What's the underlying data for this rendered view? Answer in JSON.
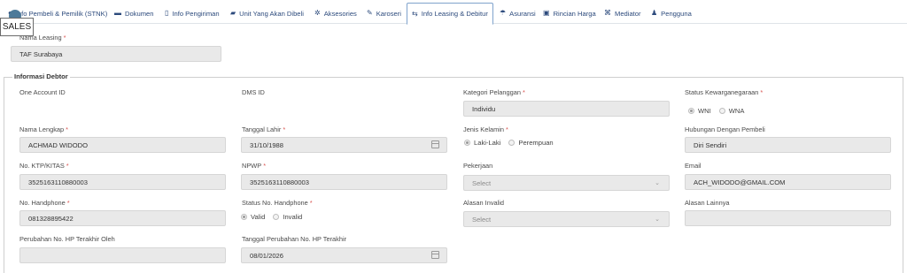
{
  "tabs": [
    {
      "label": "Info Pembeli & Pemilik (STNK)",
      "icon": "user-icon",
      "glyph": "●"
    },
    {
      "label": "Dokumen",
      "icon": "folder-icon",
      "glyph": "▬"
    },
    {
      "label": "Info Pengiriman",
      "icon": "calendar-icon",
      "glyph": "▯"
    },
    {
      "label": "Unit Yang Akan Dibeli",
      "icon": "car-icon",
      "glyph": "▰"
    },
    {
      "label": "Aksesories",
      "icon": "gears-icon",
      "glyph": "✲"
    },
    {
      "label": "Karoseri",
      "icon": "wrench-icon",
      "glyph": "✎"
    },
    {
      "label": "Info Leasing & Debitur",
      "icon": "handshake-icon",
      "glyph": "⇆"
    },
    {
      "label": "Asuransi",
      "icon": "umbrella-icon",
      "glyph": "☂"
    },
    {
      "label": "Rincian Harga",
      "icon": "money-icon",
      "glyph": "▣"
    },
    {
      "label": "Mediator",
      "icon": "sitemap-icon",
      "glyph": "⌘"
    },
    {
      "label": "Pengguna",
      "icon": "user-icon",
      "glyph": "♟"
    }
  ],
  "active_tab": "Info Leasing & Debitur",
  "sales_badge": "SALES",
  "leasing": {
    "label": "Nama Leasing",
    "value": "TAF Surabaya"
  },
  "section_title": "Informasi Debtor",
  "fields": {
    "one_account_id": {
      "label": "One Account ID"
    },
    "dms_id": {
      "label": "DMS ID"
    },
    "kategori_pelanggan": {
      "label": "Kategori Pelanggan",
      "value": "Individu"
    },
    "status_kewarganegaraan": {
      "label": "Status Kewarganegaraan",
      "options": [
        "WNI",
        "WNA"
      ],
      "selected": "WNI"
    },
    "nama_lengkap": {
      "label": "Nama Lengkap",
      "value": "ACHMAD WIDODO"
    },
    "tanggal_lahir": {
      "label": "Tanggal Lahir",
      "value": "31/10/1988"
    },
    "jenis_kelamin": {
      "label": "Jenis Kelamin",
      "options": [
        "Laki-Laki",
        "Perempuan"
      ],
      "selected": "Laki-Laki"
    },
    "hubungan": {
      "label": "Hubungan Dengan Pembeli",
      "value": "Diri Sendiri"
    },
    "no_ktp": {
      "label": "No. KTP/KITAS",
      "value": "3525163110880003"
    },
    "npwp": {
      "label": "NPWP",
      "value": "3525163110880003"
    },
    "pekerjaan": {
      "label": "Pekerjaan",
      "value": "Select"
    },
    "email": {
      "label": "Email",
      "value": "ACH_WIDODO@GMAIL.COM"
    },
    "no_handphone": {
      "label": "No. Handphone",
      "value": "081328895422"
    },
    "status_handphone": {
      "label": "Status No. Handphone",
      "options": [
        "Valid",
        "Invalid"
      ],
      "selected": "Valid"
    },
    "alasan_invalid": {
      "label": "Alasan Invalid",
      "value": "Select"
    },
    "alasan_lainnya": {
      "label": "Alasan Lainnya",
      "value": ""
    },
    "perubahan_hp_oleh": {
      "label": "Perubahan No. HP Terakhir Oleh",
      "value": ""
    },
    "tanggal_perubahan_hp": {
      "label": "Tanggal Perubahan No. HP Terakhir",
      "value": "08/01/2026"
    }
  },
  "required_mark": "*",
  "caret": "⌄"
}
